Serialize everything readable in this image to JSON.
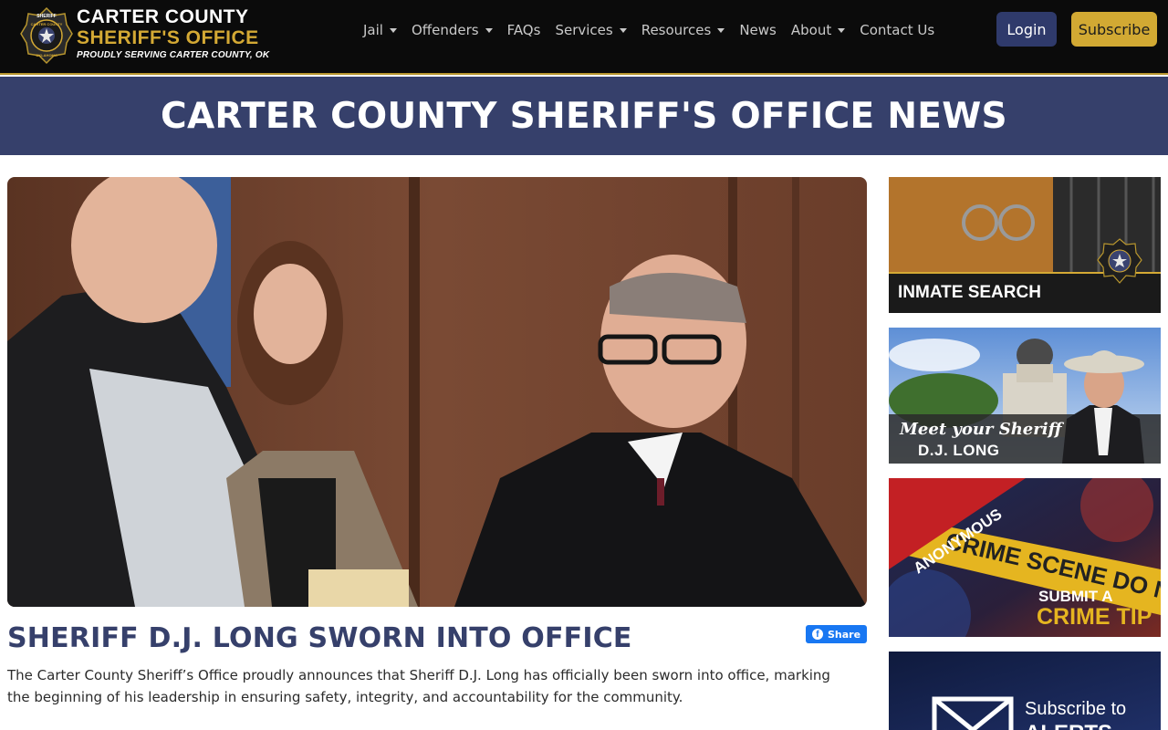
{
  "header": {
    "logo_line1": "CARTER COUNTY",
    "logo_line2": "SHERIFF'S OFFICE",
    "logo_line3": "PROUDLY SERVING CARTER COUNTY, OK",
    "badge_top": "SHERIFF",
    "badge_mid": "CARTER COUNTY",
    "badge_bottom": "OKLAHOMA",
    "nav": [
      {
        "label": "Jail",
        "dropdown": true
      },
      {
        "label": "Offenders",
        "dropdown": true
      },
      {
        "label": "FAQs",
        "dropdown": false
      },
      {
        "label": "Services",
        "dropdown": true
      },
      {
        "label": "Resources",
        "dropdown": true
      },
      {
        "label": "News",
        "dropdown": false
      },
      {
        "label": "About",
        "dropdown": true
      },
      {
        "label": "Contact Us",
        "dropdown": false
      }
    ],
    "login_label": "Login",
    "subscribe_label": "Subscribe"
  },
  "banner": {
    "title": "CARTER COUNTY SHERIFF'S OFFICE NEWS"
  },
  "article": {
    "title": "SHERIFF D.J. LONG SWORN INTO OFFICE",
    "share_label": "Share",
    "body": "The Carter County Sheriff’s Office proudly announces that Sheriff D.J. Long has officially been sworn into office, marking the beginning of his leadership in ensuring safety, integrity, and accountability for the community."
  },
  "sidebar": {
    "inmate_search": "INMATE SEARCH",
    "meet_line1": "Meet your Sheriff",
    "meet_line2": "D.J. LONG",
    "tip_ribbon": "ANONYMOUS",
    "tip_tape": "CRIME SCENE DO NOT ENTER",
    "tip_line1": "SUBMIT A",
    "tip_line2": "CRIME TIP",
    "alerts_line1": "Subscribe to",
    "alerts_line2": "ALERTS"
  },
  "colors": {
    "navy": "#36406b",
    "gold": "#d2a933",
    "black": "#0b0b0b"
  }
}
